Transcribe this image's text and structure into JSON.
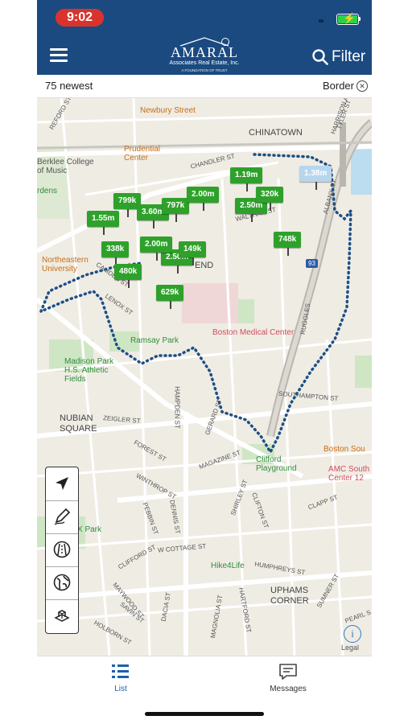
{
  "status": {
    "time": "9:02"
  },
  "header": {
    "logo_name": "Amaral",
    "logo_sub": "Associates Real Estate, Inc.",
    "logo_tag": "A FOUNDATION OF TRUST",
    "filter_label": "Filter"
  },
  "infobar": {
    "count": "75 newest",
    "border_label": "Border",
    "border_clear": "ⓧ"
  },
  "map": {
    "labels": {
      "newbury": "Newbury Street",
      "chinatown": "CHINATOWN",
      "prudential": "Prudential Center",
      "berklee": "Berklee College of Music",
      "northeastern": "Northeastern University",
      "end": "END",
      "ramsay": "Ramsay Park",
      "bmc": "Boston Medical Center",
      "madison": "Madison Park H.S. Athletic Fields",
      "nubian": "NUBIAN SQUARE",
      "clifford": "Clifford Playground",
      "boston_south": "Boston Sou",
      "amc": "AMC South Center 12",
      "hike": "Hike4Life",
      "uphams": "UPHAMS CORNER",
      "x_park": "X Park",
      "chandler": "CHANDLER ST",
      "waltham": "WALTHAM ST",
      "hampden": "HAMPDEN ST",
      "zeigler": "ZEIGLER ST",
      "magazine": "MAGAZINE ST",
      "southampton": "SOUTHAMPTON ST",
      "forest": "FOREST ST",
      "winthrop": "WINTHROP ST",
      "dennis": "DENNIS ST",
      "shirley": "SHIRLEY ST",
      "clifton": "CLIFTON ST",
      "w_cottage": "W COTTAGE ST",
      "humphreys": "HUMPHREYS ST",
      "hartford": "HARTFORD ST",
      "magnolia": "MAGNOLIA ST",
      "dacia": "DACIA ST",
      "maywood": "MAYWOOD ST",
      "holborn": "HOLBORN ST",
      "savin": "SAVIN ST",
      "clifford_st": "CLIFFORD ST",
      "pebbin": "PEBBIN ST",
      "gerard": "GERARD ST",
      "camden": "CAMDEN ST",
      "lenox": "LENOX ST",
      "clapp": "CLAPP ST",
      "sumner": "SUMNER ST",
      "pearl": "PEARL S",
      "harrison": "HARRISON AVE",
      "tyler": "TYLER ST",
      "albany": "ALBANY ST",
      "boylston": "BOYLSTON ST",
      "reford": "REFORD ST",
      "ruggles": "RUGGLES",
      "gardens": "rdens",
      "interstate": "93"
    },
    "pins": [
      "799k",
      "1.55m",
      "3.60m",
      "797k",
      "2.00m",
      "1.19m",
      "2.50m",
      "320k",
      "748k",
      "338k",
      "480k",
      "2.50m",
      "149k",
      "629k",
      "2.00m",
      "1.38m"
    ],
    "legal": "Legal",
    "info_glyph": "i"
  },
  "tabs": {
    "list": "List",
    "messages": "Messages"
  }
}
